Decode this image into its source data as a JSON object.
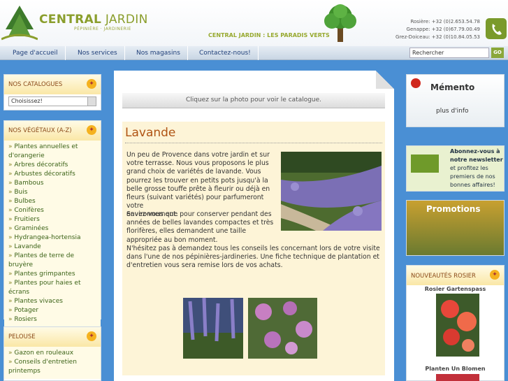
{
  "header": {
    "logo_name_a": "CENTRAL",
    "logo_name_b": "JARDIN",
    "logo_sub": "PÉPINIÈRE · JARDINERIE",
    "tagline": "CENTRAL JARDIN : LES PARADIS VERTS",
    "contacts": [
      "Rosière: +32 (0)2.653.54.78",
      "Genappe: +32 (0)67.79.00.49",
      "Grez-Doiceau: +32 (0)10.84.05.53"
    ]
  },
  "nav": {
    "items": [
      "Page d'accueil",
      "Nos services",
      "Nos magasins",
      "Contactez-nous!"
    ],
    "search_placeholder": "Rechercher",
    "search_button": "GO"
  },
  "left": {
    "catalogues": {
      "title": "NOS CATALOGUES",
      "select_value": "Choisissez!"
    },
    "vegetaux": {
      "title": "NOS VÉGÉTAUX (A-Z)",
      "items": [
        "Plantes annuelles et d'orangerie",
        "Arbres décoratifs",
        "Arbustes décoratifs",
        "Bambous",
        "Buis",
        "Bulbes",
        "Conifères",
        "Fruitiers",
        "Graminées",
        "Hydrangea-hortensia",
        "Lavande",
        "Plantes de terre de bruyère",
        "Plantes grimpantes",
        "Plantes pour haies et écrans",
        "Plantes vivaces",
        "Potager",
        "Rosiers"
      ]
    },
    "pelouse": {
      "title": "PELOUSE",
      "items": [
        "Gazon en rouleaux",
        "Conseils d'entretien printemps"
      ]
    }
  },
  "main": {
    "info": "Cliquez sur la photo pour voir le catalogue.",
    "title": "Lavande",
    "para1_lines": [
      "Un peu de Provence dans votre jardin et sur",
      "votre terrasse. Nous vous proposons le plus",
      "grand choix de variétés de lavande. Vous",
      "pourrez les trouver en petits pots jusqu'à la",
      "belle grosse touffe prête à fleurir ou déjà en",
      "fleurs (suivant variétés) pour parfumeront votre",
      "environnement."
    ],
    "para2_lines": [
      "Savez-vous que pour conserver pendant des",
      "années de belles lavandes compactes et très",
      "florifères, elles demandent une taille",
      "appropriée au bon moment."
    ],
    "para3_lines": [
      "N'hésitez pas à demandez tous les conseils les concernant lors de votre visite",
      "dans l'une de nos pépinières-jardineries. Une fiche technique de plantation et",
      "d'entretien vous sera remise lors de vos achats."
    ]
  },
  "right": {
    "memento": {
      "title": "Mémento",
      "sub": "plus d'info"
    },
    "newsletter": [
      "Abonnez-vous à",
      "notre newsletter",
      "et profitez les",
      "premiers de nos",
      "bonnes affaires!"
    ],
    "promo": "Promotions",
    "roses": {
      "title": "NOUVEAUTÉS ROSIER",
      "items": [
        "Rosier Gartenspass",
        "Planten Un Blomen"
      ]
    }
  }
}
